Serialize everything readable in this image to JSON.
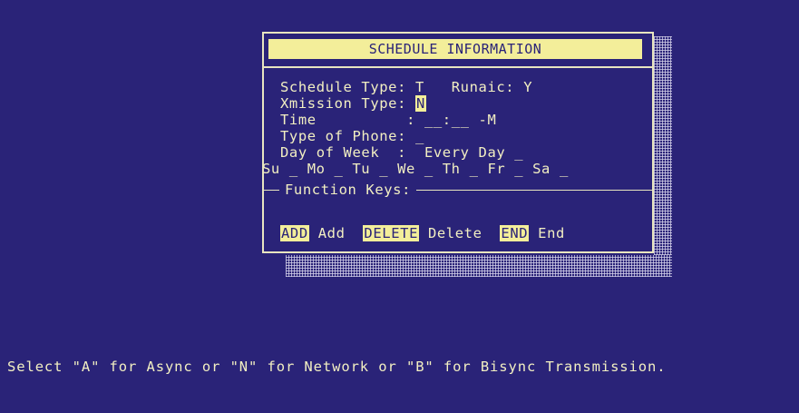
{
  "dialog": {
    "title": "SCHEDULE INFORMATION",
    "fields": {
      "schedule_type_label": "Schedule Type:",
      "schedule_type_value": "T",
      "runaic_label": "Runaic:",
      "runaic_value": "Y",
      "xmission_type_label": "Xmission Type:",
      "xmission_type_value": "N",
      "time_label": "Time",
      "time_sep": ":",
      "time_value": "__:__ -M",
      "phone_type_label": "Type of Phone:",
      "phone_type_value": "_",
      "day_of_week_label": "Day of Week",
      "day_sep": ":",
      "every_day_label": "Every Day",
      "every_day_value": "_"
    },
    "days": [
      {
        "label": "Su",
        "value": "_"
      },
      {
        "label": "Mo",
        "value": "_"
      },
      {
        "label": "Tu",
        "value": "_"
      },
      {
        "label": "We",
        "value": "_"
      },
      {
        "label": "Th",
        "value": "_"
      },
      {
        "label": "Fr",
        "value": "_"
      },
      {
        "label": "Sa",
        "value": "_"
      }
    ],
    "function_keys_label": "Function Keys:",
    "function_keys": [
      {
        "key": "ADD",
        "label": "Add"
      },
      {
        "key": "DELETE",
        "label": "Delete"
      },
      {
        "key": "END",
        "label": "End"
      }
    ]
  },
  "status_line": "Select \"A\" for Async or \"N\" for Network or \"B\" for Bisync Transmission.",
  "colors": {
    "background": "#2a2378",
    "text": "#f2efc2",
    "highlight": "#f3ee9a"
  }
}
